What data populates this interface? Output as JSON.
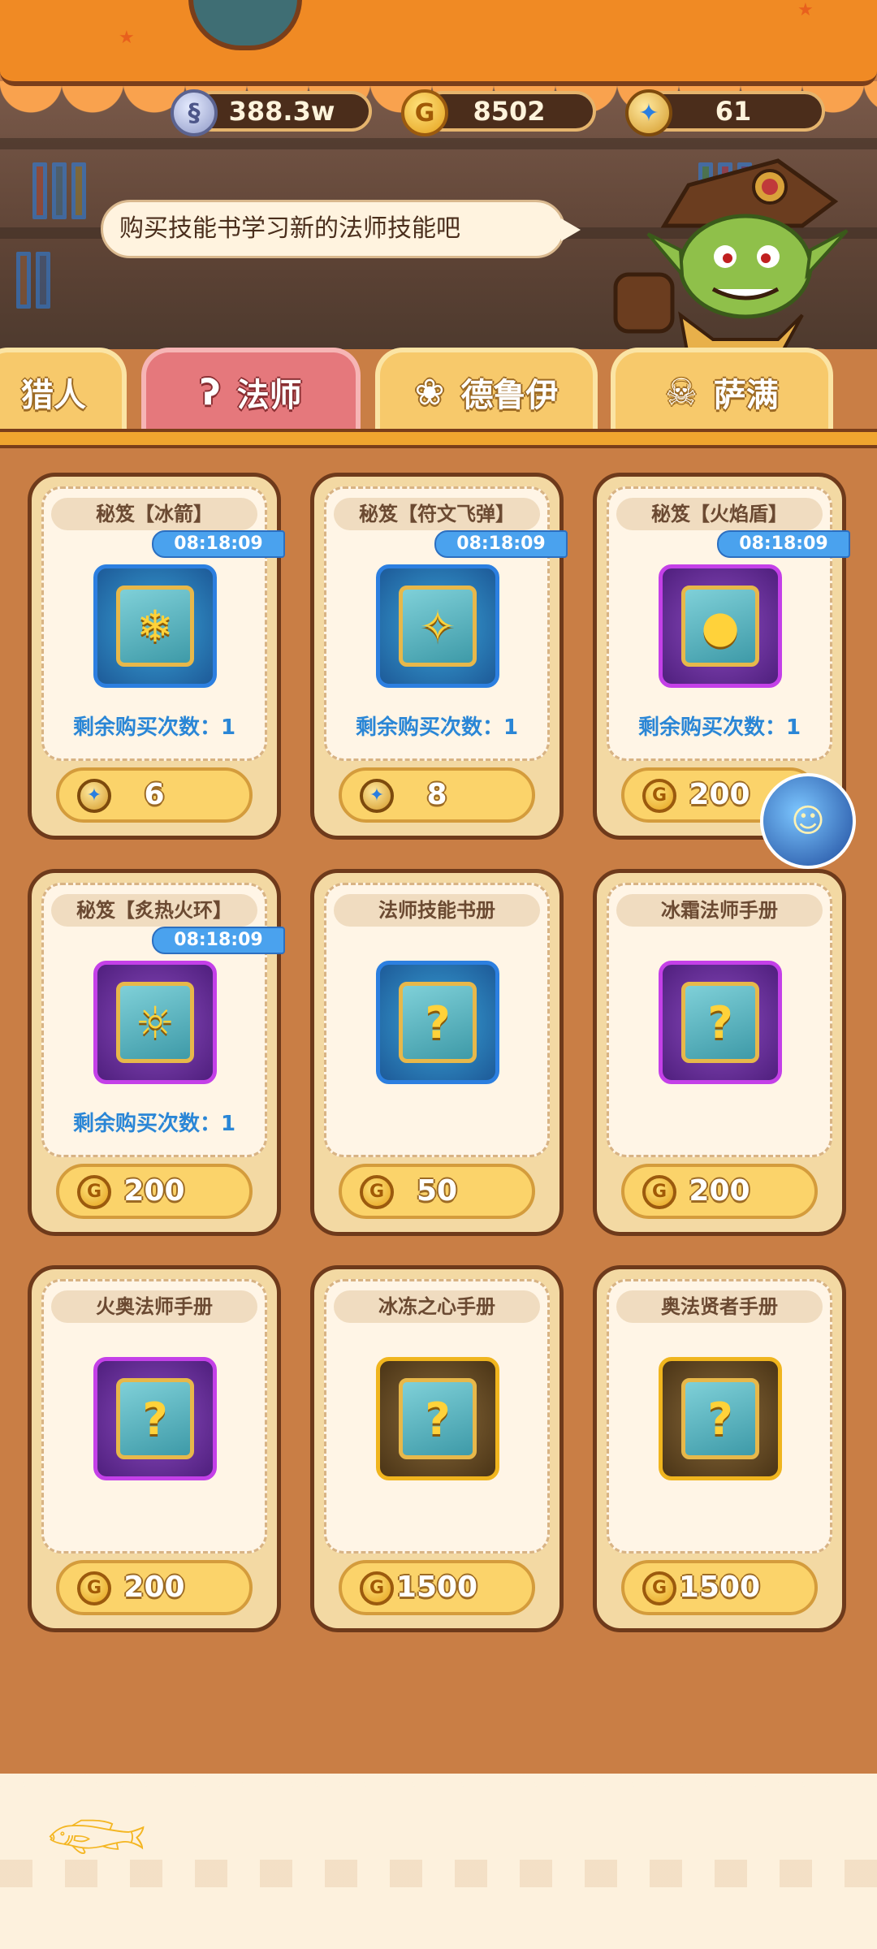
{
  "currencies": [
    {
      "name": "silver-coin",
      "icon": "silver-coin-icon",
      "value": "388.3w"
    },
    {
      "name": "gold-coin",
      "icon": "gold-coin-icon",
      "value": "8502"
    },
    {
      "name": "gem",
      "icon": "gem-icon",
      "value": "61"
    }
  ],
  "npc": {
    "speech": "购买技能书学习新的法师技能吧"
  },
  "tabs": [
    {
      "label": "猎人",
      "icon": "hunter-icon"
    },
    {
      "label": "法师",
      "icon": "mage-icon",
      "active": true
    },
    {
      "label": "德鲁伊",
      "icon": "paw-icon"
    },
    {
      "label": "萨满",
      "icon": "shaman-icon"
    }
  ],
  "remain_label": "剩余购买次数：1",
  "items": [
    {
      "title": "秘笈【冰箭】",
      "timer": "08:18:09",
      "remain": "剩余购买次数：1",
      "price": "6",
      "currency": "gem",
      "frame": "blue"
    },
    {
      "title": "秘笈【符文飞弹】",
      "timer": "08:18:09",
      "remain": "剩余购买次数：1",
      "price": "8",
      "currency": "gem",
      "frame": "blue"
    },
    {
      "title": "秘笈【火焰盾】",
      "timer": "08:18:09",
      "remain": "剩余购买次数：1",
      "price": "200",
      "currency": "gold",
      "frame": "purple"
    },
    {
      "title": "秘笈【炙热火环】",
      "timer": "08:18:09",
      "remain": "剩余购买次数：1",
      "price": "200",
      "currency": "gold",
      "frame": "purple"
    },
    {
      "title": "法师技能书册",
      "price": "50",
      "currency": "gold",
      "frame": "blue"
    },
    {
      "title": "冰霜法师手册",
      "price": "200",
      "currency": "gold",
      "frame": "purple"
    },
    {
      "title": "火奥法师手册",
      "price": "200",
      "currency": "gold",
      "frame": "purple"
    },
    {
      "title": "冰冻之心手册",
      "price": "1500",
      "currency": "gold",
      "frame": "gold"
    },
    {
      "title": "奥法贤者手册",
      "price": "1500",
      "currency": "gold",
      "frame": "gold"
    }
  ],
  "colors": {
    "accent": "#f08a24",
    "timer": "#4aa2ee",
    "remain": "#2a86d6",
    "active_tab": "#e5787c"
  }
}
